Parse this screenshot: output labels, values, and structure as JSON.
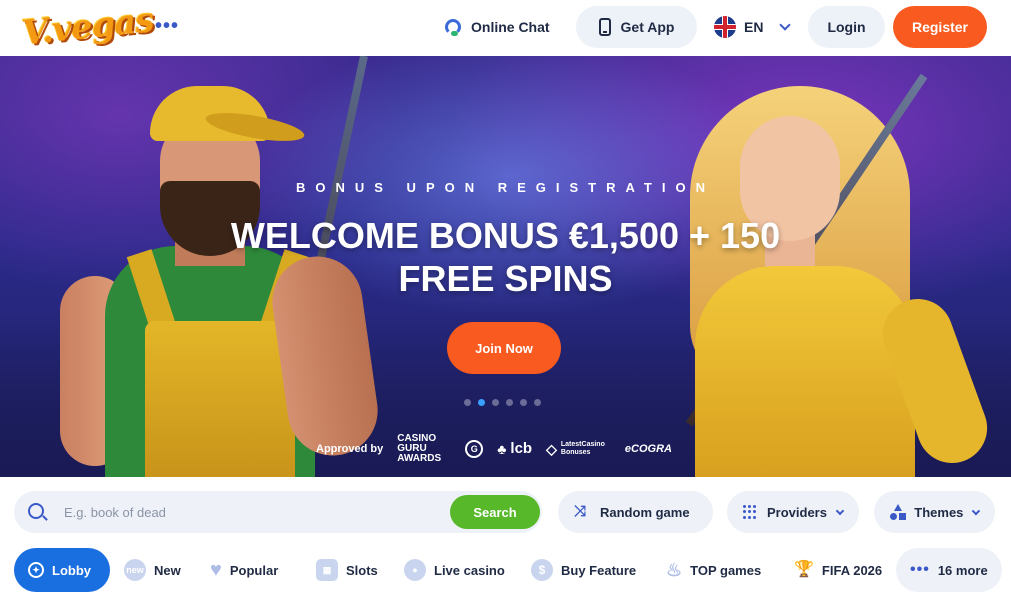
{
  "header": {
    "logo_text": "V.vegas",
    "online_chat": "Online Chat",
    "get_app": "Get App",
    "language": "EN",
    "login": "Login",
    "register": "Register"
  },
  "hero": {
    "subtitle": "BONUS UPON REGISTRATION",
    "title": "WELCOME BONUS €1,500 + 150 FREE SPINS",
    "cta": "Join Now",
    "slides_total": 6,
    "slides_active_index": 1,
    "approved_by": "Approved by",
    "awards": [
      "CASINO GURU AWARDS",
      "lcb",
      "LatestCasino Bonuses",
      "eCOGRA"
    ]
  },
  "search": {
    "placeholder": "E.g. book of dead",
    "value": "",
    "button": "Search"
  },
  "filters": {
    "random_game": "Random game",
    "providers": "Providers",
    "themes": "Themes"
  },
  "categories": [
    {
      "label": "Lobby",
      "icon": "lobby-icon",
      "active": true
    },
    {
      "label": "New",
      "icon": "new-badge-icon",
      "active": false
    },
    {
      "label": "Popular",
      "icon": "heart-icon",
      "active": false
    },
    {
      "label": "Slots",
      "icon": "slot-machine-icon",
      "active": false
    },
    {
      "label": "Live casino",
      "icon": "live-icon",
      "active": false
    },
    {
      "label": "Buy Feature",
      "icon": "dollar-icon",
      "active": false
    },
    {
      "label": "TOP games",
      "icon": "flame-icon",
      "active": false
    },
    {
      "label": "FIFA 2026",
      "icon": "trophy-icon",
      "active": false
    },
    {
      "label": "16 more",
      "icon": "more-dots-icon",
      "active": false
    }
  ],
  "colors": {
    "accent_orange": "#f85a1f",
    "search_green": "#57b82a",
    "active_blue": "#1a6fe0",
    "icon_blue": "#3a59c7"
  }
}
